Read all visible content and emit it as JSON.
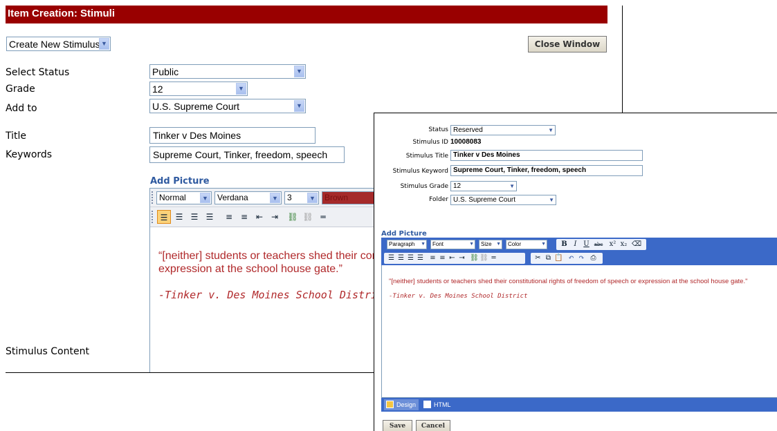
{
  "back_window": {
    "title": "Item Creation: Stimuli",
    "mode_select": "Create New Stimulus",
    "close_button": "Close Window",
    "fields": {
      "status_label": "Select Status",
      "status_value": "Public",
      "grade_label": "Grade",
      "grade_value": "12",
      "add_to_label": "Add to",
      "add_to_value": "U.S. Supreme Court",
      "title_label": "Title",
      "title_value": "Tinker v Des Moines",
      "keywords_label": "Keywords",
      "keywords_value": "Supreme Court, Tinker, freedom, speech",
      "content_label": "Stimulus Content"
    },
    "add_picture": "Add Picture",
    "editor": {
      "format_select": "Normal",
      "font_select": "Verdana",
      "size_select": "3",
      "color_select": "Brown",
      "quote": "“[neither] students or teachers shed their constitutional rights of freedom of speech or expression at the school house gate.”",
      "citation": "-Tinker v. Des Moines School District"
    }
  },
  "front_window": {
    "status_label": "Status",
    "status_value": "Reserved",
    "stimulus_id_label": "Stimulus ID",
    "stimulus_id_value": "10008083",
    "title_label": "Stimulus Title",
    "title_value": "Tinker v Des Moines",
    "keyword_label": "Stimulus Keyword",
    "keyword_value": "Supreme Court, Tinker, freedom, speech",
    "grade_label": "Stimulus Grade",
    "grade_value": "12",
    "folder_label": "Folder",
    "folder_value": "U.S. Supreme Court",
    "add_picture": "Add Picture",
    "toolbar": {
      "paragraph": "Paragraph",
      "font": "Font",
      "size": "Size",
      "color": "Color",
      "bold": "B",
      "italic": "I",
      "underline": "U",
      "strike": "abc",
      "superscript": "x²",
      "subscript": "x₂"
    },
    "quote": "\"[neither] students or teachers shed their constitutional rights of freedom of speech or expression at the school house gate.\"",
    "citation": "-Tinker v. Des Moines School District",
    "tabs": {
      "design": "Design",
      "html": "HTML"
    },
    "save_button": "Save",
    "cancel_button": "Cancel"
  },
  "colors": {
    "title_bar": "#990000",
    "toolbar_blue": "#3b69c8",
    "quote_text": "#b0282a",
    "heading_blue": "#2f5aa0"
  }
}
